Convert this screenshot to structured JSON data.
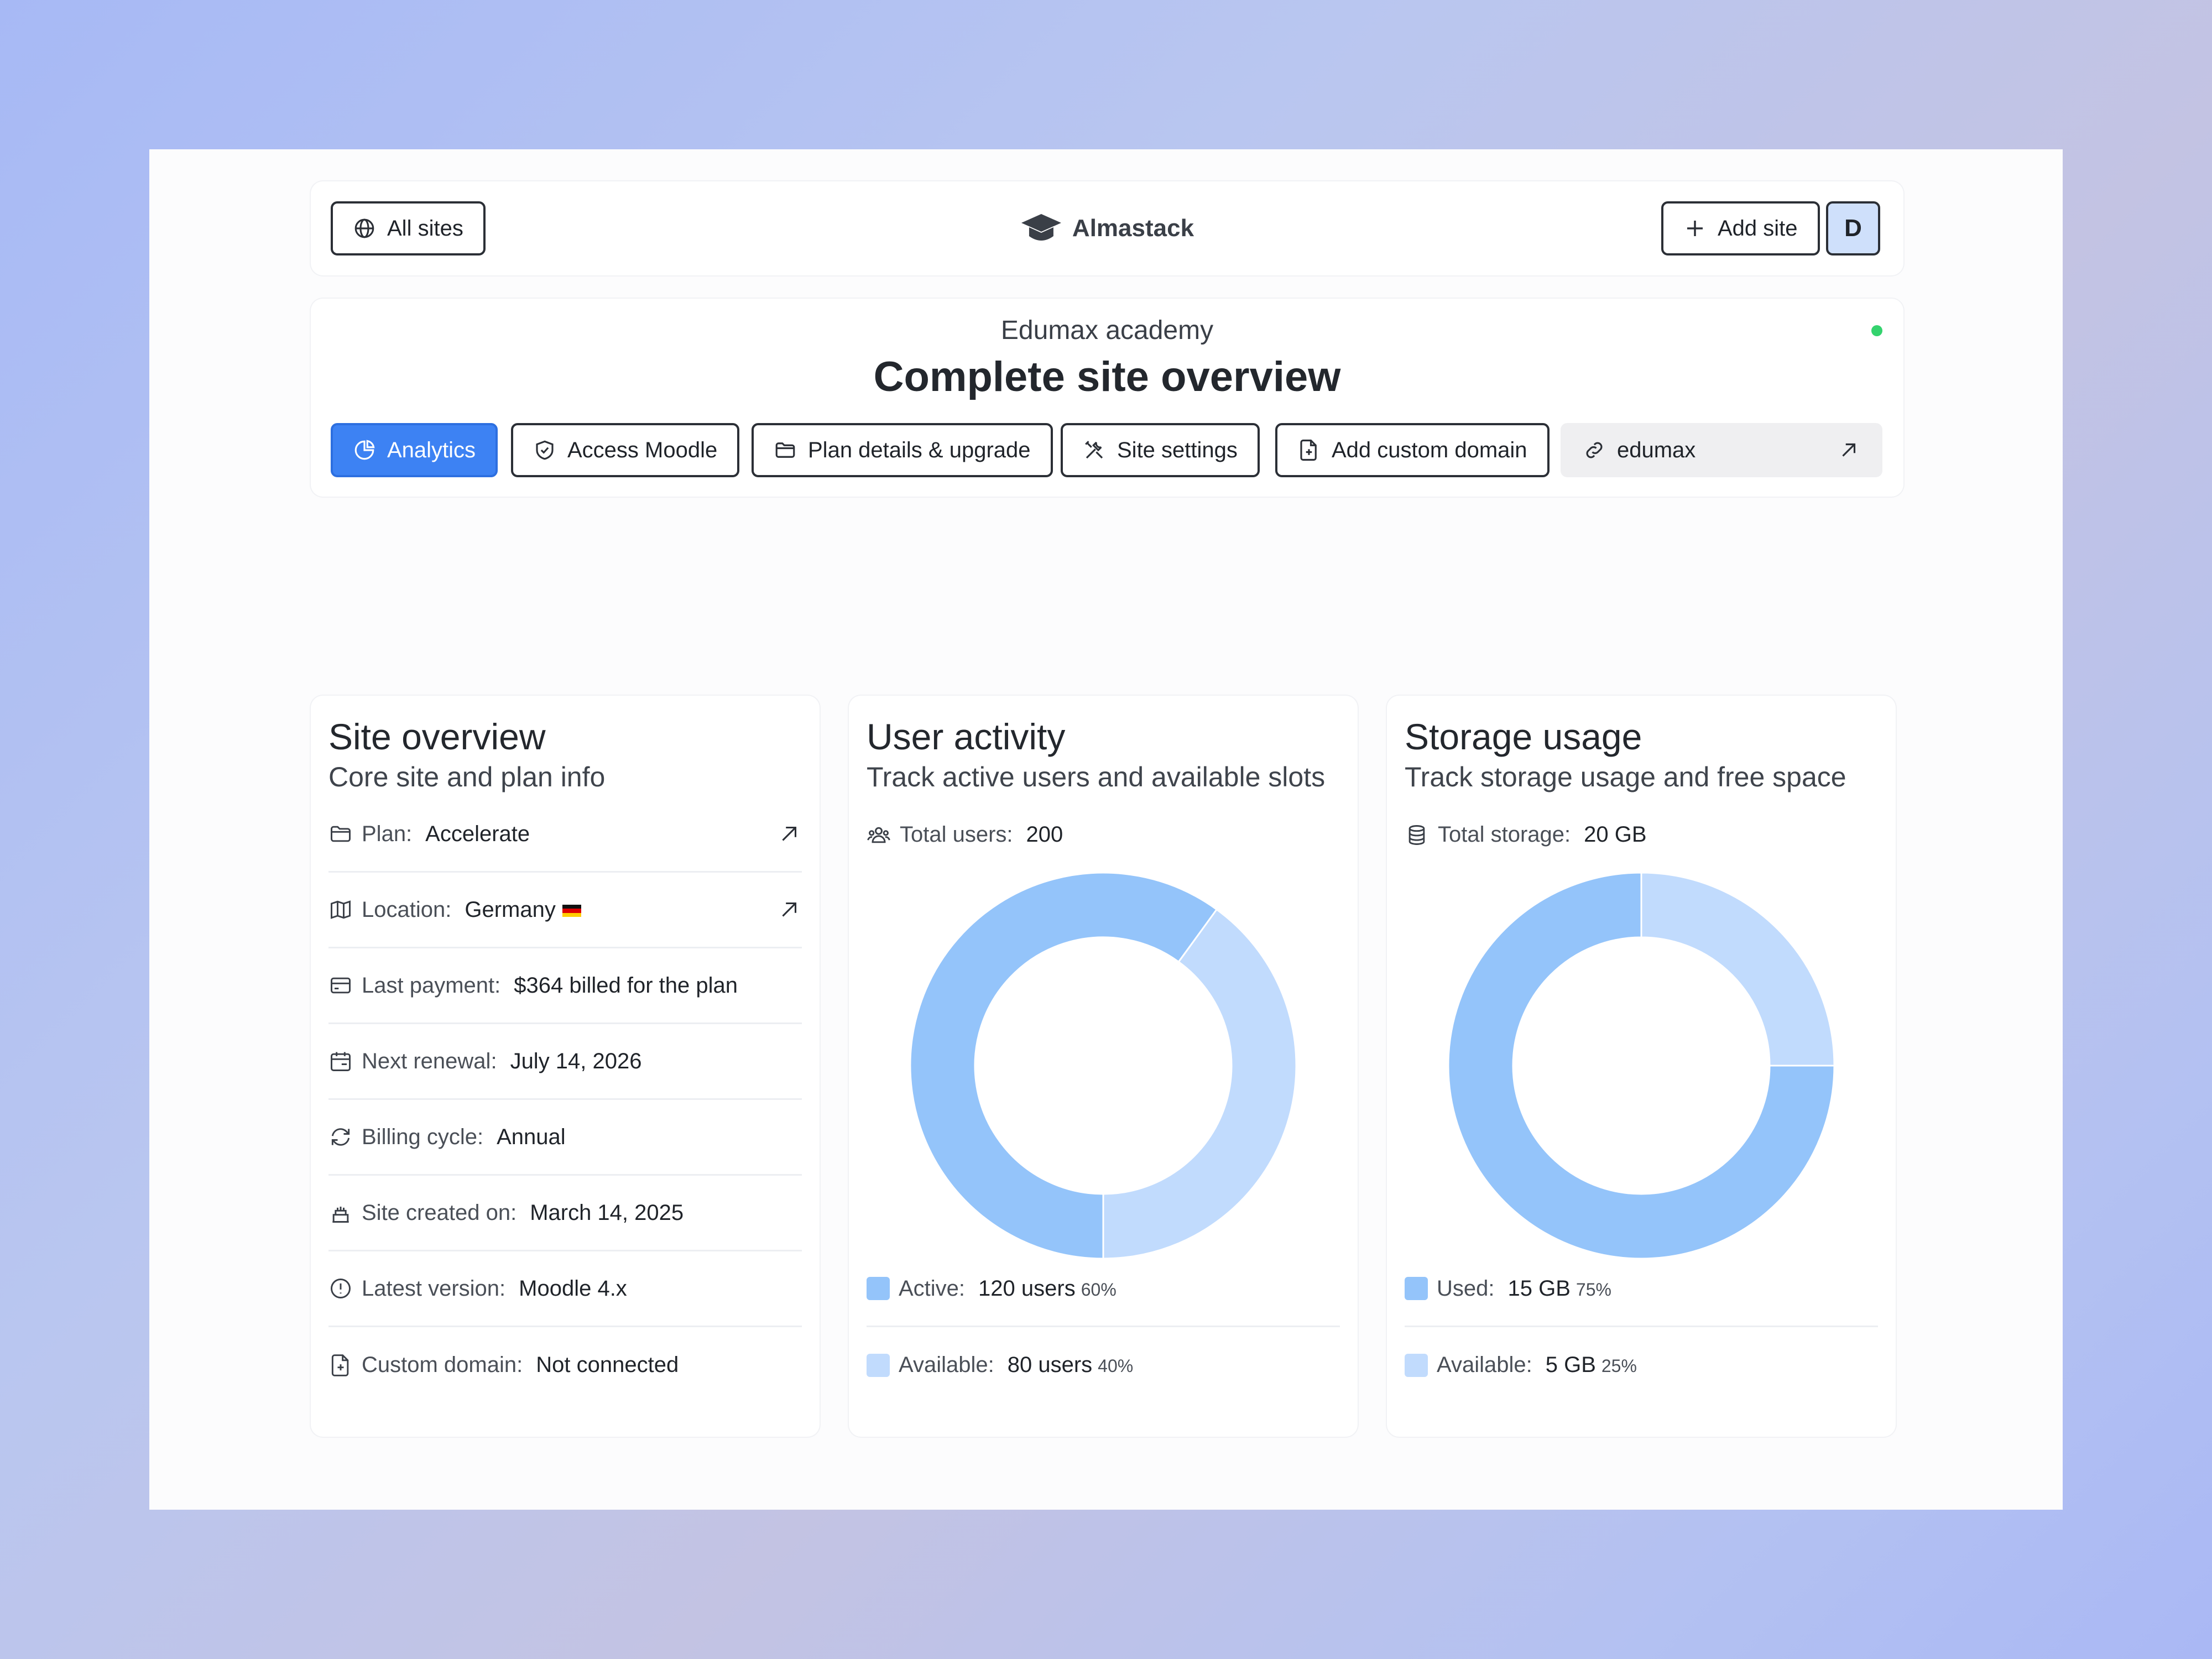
{
  "topbar": {
    "all_sites_label": "All sites",
    "brand_name": "Almastack",
    "add_site_label": "Add site",
    "avatar_initial": "D"
  },
  "header": {
    "site_name": "Edumax academy",
    "title": "Complete site overview",
    "status": "online",
    "tabs": [
      {
        "label": "Analytics",
        "icon": "pie-chart-icon",
        "active": true
      },
      {
        "label": "Access Moodle",
        "icon": "shield-check-icon"
      },
      {
        "label": "Plan details & upgrade",
        "icon": "folder-icon"
      },
      {
        "label": "Site settings",
        "icon": "tools-icon"
      },
      {
        "label": "Add custom domain",
        "icon": "file-plus-icon"
      }
    ],
    "site_link": {
      "label": "edumax",
      "icon": "link-icon"
    }
  },
  "site_overview": {
    "title": "Site overview",
    "subtitle": "Core site and plan info",
    "rows": [
      {
        "label": "Plan:",
        "value": "Accelerate",
        "icon": "folder-icon",
        "link": true
      },
      {
        "label": "Location:",
        "value": "Germany",
        "icon": "map-icon",
        "link": true,
        "flag": "DE"
      },
      {
        "label": "Last payment:",
        "value": "$364 billed for the plan",
        "icon": "credit-card-icon"
      },
      {
        "label": "Next renewal:",
        "value": "July 14, 2026",
        "icon": "calendar-icon"
      },
      {
        "label": "Billing cycle:",
        "value": "Annual",
        "icon": "refresh-icon"
      },
      {
        "label": "Site created on:",
        "value": "March 14, 2025",
        "icon": "cake-icon"
      },
      {
        "label": "Latest version:",
        "value": "Moodle 4.x",
        "icon": "info-icon"
      },
      {
        "label": "Custom domain:",
        "value": "Not connected",
        "icon": "file-plus-icon"
      }
    ]
  },
  "user_activity": {
    "title": "User activity",
    "subtitle": "Track active users and available slots",
    "total_label": "Total users:",
    "total_value": "200",
    "legend": [
      {
        "label": "Active:",
        "value": "120 users",
        "pct": "60%"
      },
      {
        "label": "Available:",
        "value": "80 users",
        "pct": "40%"
      }
    ]
  },
  "storage_usage": {
    "title": "Storage usage",
    "subtitle": "Track storage usage and free space",
    "total_label": "Total storage:",
    "total_value": "20 GB",
    "legend": [
      {
        "label": "Used:",
        "value": "15 GB",
        "pct": "75%"
      },
      {
        "label": "Available:",
        "value": "5 GB",
        "pct": "25%"
      }
    ]
  },
  "colors": {
    "primary": "#3d82f3",
    "slice_dark": "#94c4fa",
    "slice_light": "#c1dbfd",
    "status_online": "#34d36e"
  },
  "chart_data": [
    {
      "type": "pie",
      "categories": [
        "Active",
        "Available"
      ],
      "values": [
        120,
        80
      ],
      "colors": [
        "#94c4fa",
        "#c1dbfd"
      ]
    },
    {
      "type": "pie",
      "categories": [
        "Used",
        "Available"
      ],
      "values": [
        15,
        5
      ],
      "colors": [
        "#94c4fa",
        "#c1dbfd"
      ]
    }
  ]
}
